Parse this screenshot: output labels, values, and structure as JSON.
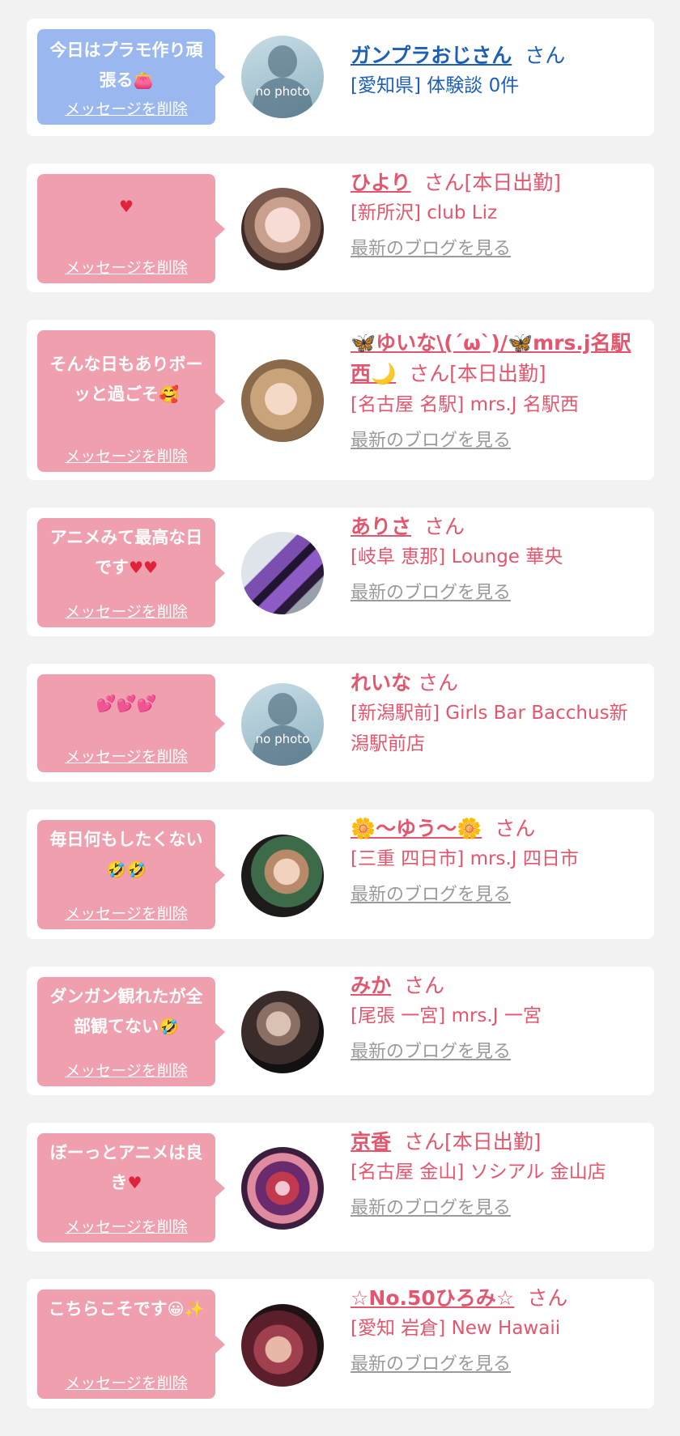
{
  "colors": {
    "pink_bubble": "#ef9fae",
    "blue_bubble": "#9ab8ef",
    "pink_text": "#e4566d",
    "blue_text": "#1b5fb8",
    "link_gray": "#9a9a9a"
  },
  "delete_label": "メッセージを削除",
  "blog_label": "最新のブログを見る",
  "entries": [
    {
      "message": "今日はプラモ作り頑張る",
      "message_emoji": "👛",
      "bubble_color": "blue",
      "name": "ガンプラおじさん",
      "suffix": "さん",
      "location": "[愛知県] 体験談 0件",
      "avatar": "no-photo",
      "avatar_label": "no photo",
      "has_blog": false
    },
    {
      "message": "",
      "message_emoji": "♥",
      "bubble_color": "pink",
      "name": "ひより",
      "suffix": "さん[本日出勤]",
      "location": "[新所沢] club Liz",
      "avatar": "photo",
      "has_blog": true
    },
    {
      "message": "そんな日もありボーッと過ごそ",
      "message_emoji": "🥰",
      "bubble_color": "pink",
      "name": "🦋ゆいな\\(´ω`)/🦋mrs.j名駅西🌙",
      "suffix": "さん[本日出勤]",
      "location": "[名古屋 名駅] mrs.J 名駅西",
      "avatar": "photo",
      "has_blog": true
    },
    {
      "message": "アニメみて最高な日です",
      "message_emoji": "♥♥",
      "bubble_color": "pink",
      "name": "ありさ",
      "suffix": "さん",
      "location": "[岐阜 恵那] Lounge 華央",
      "avatar": "photo",
      "has_blog": true
    },
    {
      "message": "",
      "message_emoji": "💕💕💕",
      "bubble_color": "pink",
      "name": "れいな",
      "suffix": "さん",
      "location": "[新潟駅前] Girls Bar Bacchus新潟駅前店",
      "avatar": "no-photo",
      "avatar_label": "no photo",
      "has_blog": false
    },
    {
      "message": "毎日何もしたくない",
      "message_emoji": "🤣🤣",
      "bubble_color": "pink",
      "name": "🌼〜ゆう〜🌼",
      "suffix": "さん",
      "location": "[三重 四日市] mrs.J 四日市",
      "avatar": "photo",
      "has_blog": true
    },
    {
      "message": "ダンガン観れたが全部観てない",
      "message_emoji": "🤣",
      "bubble_color": "pink",
      "name": "みか",
      "suffix": "さん",
      "location": "[尾張 一宮] mrs.J 一宮",
      "avatar": "photo",
      "has_blog": true
    },
    {
      "message": "ぼーっとアニメは良き",
      "message_emoji": "♥",
      "bubble_color": "pink",
      "name": "京香",
      "suffix": "さん[本日出勤]",
      "location": "[名古屋 金山] ソシアル 金山店",
      "avatar": "photo",
      "has_blog": true
    },
    {
      "message": "こちらこそです",
      "message_emoji": "😀✨",
      "bubble_color": "pink",
      "name": "☆No.50ひろみ☆",
      "suffix": "さん",
      "location": "[愛知 岩倉] New Hawaii",
      "avatar": "photo",
      "has_blog": true
    }
  ]
}
